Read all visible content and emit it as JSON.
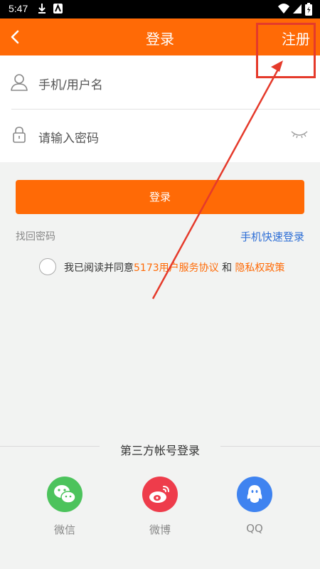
{
  "status_bar": {
    "time": "5:47"
  },
  "header": {
    "title": "登录",
    "register_label": "注册"
  },
  "form": {
    "username_placeholder": "手机/用户名",
    "password_placeholder": "请输入密码"
  },
  "login_button": {
    "label": "登录"
  },
  "links": {
    "forgot_password": "找回密码",
    "quick_login": "手机快速登录"
  },
  "agreement": {
    "prefix": "我已阅读并同意",
    "user_agreement": "5173用户服务协议",
    "and": " 和 ",
    "privacy": "隐私权政策"
  },
  "third_party": {
    "title": "第三方帐号登录",
    "items": [
      {
        "label": "微信",
        "icon": "wechat-icon",
        "color": "#4cc35c"
      },
      {
        "label": "微博",
        "icon": "weibo-icon",
        "color": "#ee3c4b"
      },
      {
        "label": "QQ",
        "icon": "qq-icon",
        "color": "#3f83f0"
      }
    ]
  },
  "colors": {
    "brand": "#ff6a06",
    "link": "#2f6fd6",
    "annotation": "#e53a2b"
  }
}
